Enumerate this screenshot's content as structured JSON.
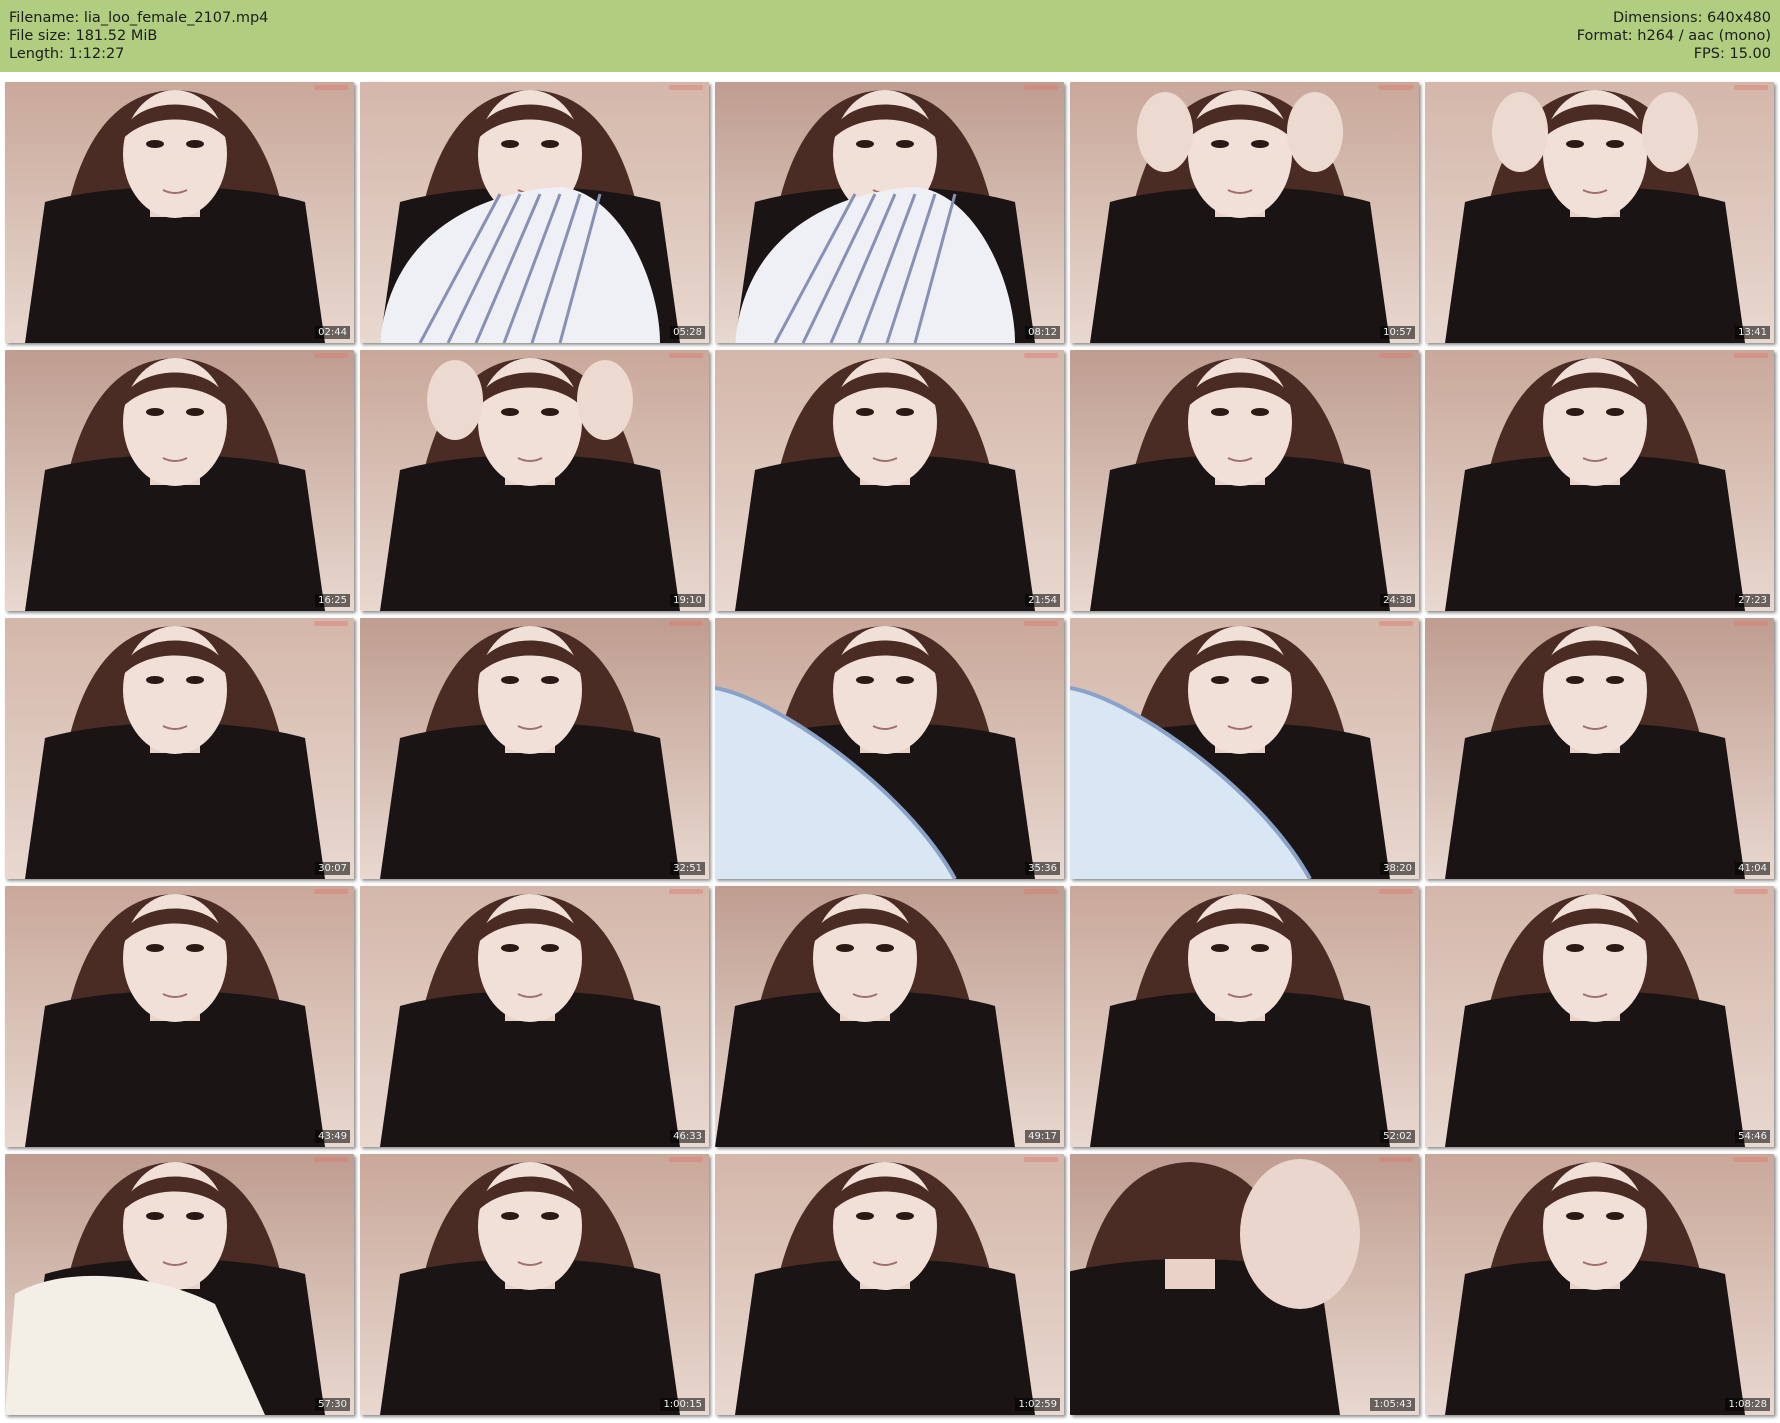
{
  "header": {
    "filename_line": "Filename: lia_loo_female_2107.mp4",
    "filesize_line": "File size: 181.52 MiB",
    "length_line": "Length: 1:12:27",
    "dimensions_line": "Dimensions: 640x480",
    "format_line": "Format: h264 / aac (mono)",
    "fps_line": "FPS: 15.00",
    "background_color": "#b0cd80"
  },
  "grid": {
    "columns": 5,
    "rows": 5,
    "thumbnails": [
      {
        "timestamp": "02:44",
        "scene": "face"
      },
      {
        "timestamp": "05:28",
        "scene": "pillow"
      },
      {
        "timestamp": "08:12",
        "scene": "pillow"
      },
      {
        "timestamp": "10:57",
        "scene": "hands-face"
      },
      {
        "timestamp": "13:41",
        "scene": "hands-shirt"
      },
      {
        "timestamp": "16:25",
        "scene": "face"
      },
      {
        "timestamp": "19:10",
        "scene": "hands-face"
      },
      {
        "timestamp": "21:54",
        "scene": "face"
      },
      {
        "timestamp": "24:38",
        "scene": "face"
      },
      {
        "timestamp": "27:23",
        "scene": "face"
      },
      {
        "timestamp": "30:07",
        "scene": "face"
      },
      {
        "timestamp": "32:51",
        "scene": "face"
      },
      {
        "timestamp": "35:36",
        "scene": "pillow-blue"
      },
      {
        "timestamp": "38:20",
        "scene": "pillow-blue"
      },
      {
        "timestamp": "41:04",
        "scene": "face"
      },
      {
        "timestamp": "43:49",
        "scene": "face"
      },
      {
        "timestamp": "46:33",
        "scene": "face"
      },
      {
        "timestamp": "49:17",
        "scene": "face-side"
      },
      {
        "timestamp": "52:02",
        "scene": "face"
      },
      {
        "timestamp": "54:46",
        "scene": "face"
      },
      {
        "timestamp": "57:30",
        "scene": "blanket"
      },
      {
        "timestamp": "1:00:15",
        "scene": "face-far"
      },
      {
        "timestamp": "1:02:59",
        "scene": "face"
      },
      {
        "timestamp": "1:05:43",
        "scene": "hair-close"
      },
      {
        "timestamp": "1:08:28",
        "scene": "face"
      }
    ]
  }
}
